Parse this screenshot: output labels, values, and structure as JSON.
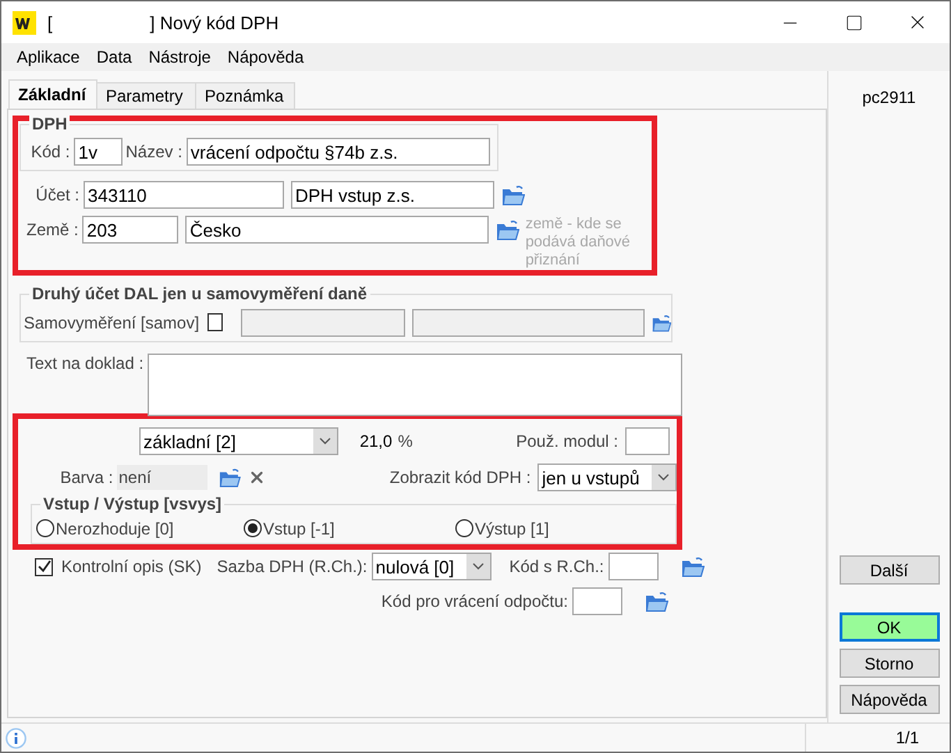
{
  "window": {
    "title_prefix": "[",
    "title": "] Nový kód DPH"
  },
  "menu": [
    "Aplikace",
    "Data",
    "Nástroje",
    "Nápověda"
  ],
  "tabs": [
    {
      "label": "Základní",
      "selected": true
    },
    {
      "label": "Parametry",
      "selected": false
    },
    {
      "label": "Poznámka",
      "selected": false
    }
  ],
  "computer": "pc2911",
  "dph": {
    "legend": "DPH",
    "kod_label": "Kód :",
    "kod": "1v",
    "nazev_label": "Název :",
    "nazev": "vrácení odpočtu §74b z.s.",
    "ucet_label": "Účet :",
    "ucet": "343110",
    "ucet_name": "DPH vstup z.s.",
    "zeme_label": "Země :",
    "zeme": "203",
    "zeme_name": "Česko",
    "zeme_hint": "země - kde se podává daňové přiznání"
  },
  "druhy": {
    "legend": "Druhý účet DAL jen u samovyměření daně",
    "label": "Samovyměření [samov]",
    "checked": false
  },
  "text_label": "Text na doklad :",
  "sazba": {
    "value": "základní [2]",
    "percent": "21,0",
    "unit": "%",
    "modul_label": "Použ. modul :",
    "barva_label": "Barva :",
    "barva": "není",
    "zobrazit_label": "Zobrazit kód DPH :",
    "zobrazit": "jen u vstupů"
  },
  "vsvys": {
    "legend": "Vstup / Výstup [vsvys]",
    "options": [
      {
        "label": "Nerozhoduje [0]",
        "selected": false
      },
      {
        "label": "Vstup [-1]",
        "selected": true
      },
      {
        "label": "Výstup [1]",
        "selected": false
      }
    ]
  },
  "kontrolni": {
    "label": "Kontrolní opis (SK)",
    "checked": true
  },
  "sazba_rch": {
    "label": "Sazba DPH (R.Ch.):",
    "value": "nulová [0]"
  },
  "kod_rch_label": "Kód s R.Ch.:",
  "kod_vraceni_label": "Kód pro vrácení odpočtu:",
  "buttons": [
    {
      "label": "Další",
      "kind": "normal"
    },
    {
      "label": "OK",
      "kind": "default"
    },
    {
      "label": "Storno",
      "kind": "normal"
    },
    {
      "label": "Nápověda",
      "kind": "normal"
    }
  ],
  "status": {
    "page": "1/1"
  }
}
